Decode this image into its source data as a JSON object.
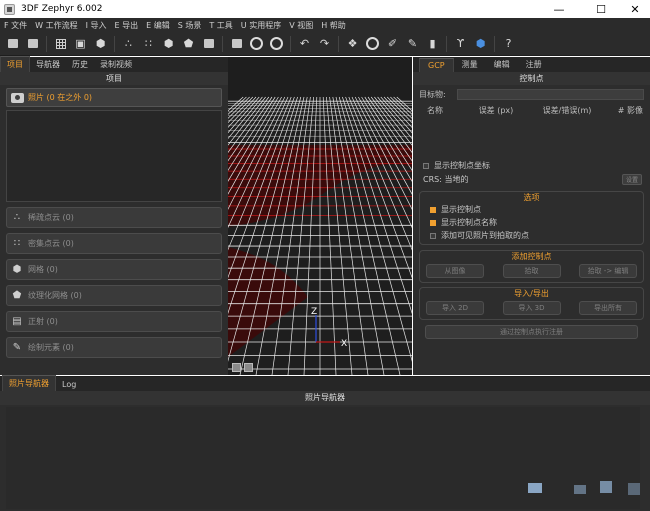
{
  "window": {
    "title": "3DF Zephyr 6.002",
    "minimize": "—",
    "maximize": "☐",
    "close": "✕"
  },
  "menu": [
    "F 文件",
    "W 工作流程",
    "I 导入",
    "E 导出",
    "E 编辑",
    "S 场景",
    "T 工具",
    "U 实用程序",
    "V 视图",
    "H 帮助"
  ],
  "toolbar": {
    "icons": [
      "folder-icon",
      "save-icon",
      "grid-icon",
      "cube-icon",
      "cube-solid-icon",
      "points-icon",
      "points-dense-icon",
      "mesh-icon",
      "textured-mesh-icon",
      "orthophoto-icon",
      "camera-icon",
      "refresh-icon",
      "rotate-icon",
      "undo-icon",
      "redo-icon",
      "select-icon",
      "circle-select-icon",
      "axes-icon",
      "ruler-icon",
      "stats-icon",
      "wrench-icon",
      "view-cube-icon",
      "help-icon"
    ],
    "help_glyph": "?"
  },
  "left_panel": {
    "tabs": [
      "项目",
      "导航器",
      "历史",
      "录制视频"
    ],
    "active_tab": 0,
    "title": "项目",
    "photos_label": "照片 (0 在之外 0)",
    "items": [
      {
        "label": "稀疏点云 (0)",
        "icon": "sparse-cloud-icon"
      },
      {
        "label": "密集点云 (0)",
        "icon": "dense-cloud-icon"
      },
      {
        "label": "网格 (0)",
        "icon": "mesh-icon"
      },
      {
        "label": "纹理化网格 (0)",
        "icon": "textured-mesh-icon"
      },
      {
        "label": "正射 (0)",
        "icon": "ortho-icon"
      },
      {
        "label": "绘制元素 (0)",
        "icon": "drawing-icon"
      }
    ]
  },
  "viewport": {
    "axis_z": "Z",
    "axis_x": "X",
    "colors": {
      "grid": "#e8e8e8",
      "red_grid": "#c01818",
      "background": "#1e1e1e"
    }
  },
  "right_panel": {
    "tabs": [
      "GCP",
      "测量",
      "编辑",
      "注册"
    ],
    "active_tab": 0,
    "title": "控制点",
    "target_label": "目标物:",
    "columns": [
      "名称",
      "误差 (px)",
      "误差/错误(m)",
      "# 影像"
    ],
    "show_coords": "显示控制点坐标",
    "crs_label": "CRS:",
    "crs_value": "当地的",
    "crs_button": "设置",
    "options": {
      "title": "选项",
      "items": [
        {
          "label": "显示控制点",
          "checked": true
        },
        {
          "label": "显示控制点名称",
          "checked": true
        },
        {
          "label": "添加可见照片到拍取的点",
          "checked": false
        }
      ]
    },
    "add_cp": {
      "title": "添加控制点",
      "buttons": [
        "从图像",
        "拾取",
        "拾取 -> 编辑"
      ]
    },
    "import_export": {
      "title": "导入/导出",
      "buttons": [
        "导入 2D",
        "导入 3D",
        "导出所有"
      ]
    },
    "bottom_button": "通过控制点执行注册"
  },
  "bottom_panel": {
    "tabs": [
      "照片导航器",
      "Log"
    ],
    "active_tab": 0,
    "title": "照片导航器"
  },
  "accent": "#f0a030"
}
